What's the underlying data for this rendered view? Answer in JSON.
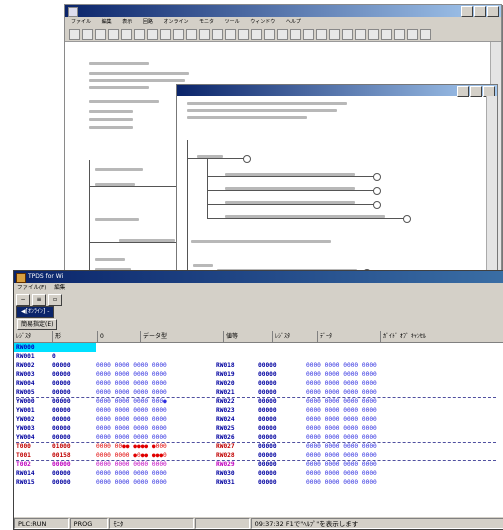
{
  "back_window": {
    "menu": [
      "ファイル",
      "編集",
      "表示",
      "回路",
      "オンライン",
      "モニタ",
      "ツール",
      "ウィンドウ",
      "ヘルプ"
    ]
  },
  "front_window": {
    "title": "TPDS for Wi",
    "menu": [
      "ファイル(F)",
      "編集"
    ],
    "mode_tab": "◀[ｵﾝﾗｲﾝ] -",
    "spec_button": "簡易指定(E)",
    "header": {
      "reg": "ﾚｼﾞｽﾀ",
      "fmt": "形",
      "lbl_a": "0",
      "lbl_b": "データ型",
      "lbl_c": "値等",
      "lbl_d": "ﾚｼﾞｽﾀ",
      "lbl_e": "ﾃﾞｰﾀ",
      "lbl_f": "ｶﾞｲﾄﾞ ｵﾌﾞ ｷｬﾝｾﾙ"
    },
    "rows": [
      {
        "name": "RW000",
        "val": "",
        "bits": "",
        "name2": "",
        "val2": "",
        "bits2": "",
        "style": "selected"
      },
      {
        "name": "RW001",
        "val": "0",
        "bits": "",
        "name2": "",
        "val2": "",
        "bits2": "",
        "style": ""
      },
      {
        "name": "RW002",
        "val": "00000",
        "bits": "0000 0000 0000 0000",
        "name2": "RW018",
        "val2": "00000",
        "bits2": "0000 0000 0000 0000",
        "style": ""
      },
      {
        "name": "RW003",
        "val": "00000",
        "bits": "0000 0000 0000 0000",
        "name2": "RW019",
        "val2": "00000",
        "bits2": "0000 0000 0000 0000",
        "style": ""
      },
      {
        "name": "RW004",
        "val": "00000",
        "bits": "0000 0000 0000 0000",
        "name2": "RW020",
        "val2": "00000",
        "bits2": "0000 0000 0000 0000",
        "style": ""
      },
      {
        "name": "RW005",
        "val": "00000",
        "bits": "0000 0000 0000 0000",
        "name2": "RW021",
        "val2": "00000",
        "bits2": "0000 0000 0000 0000",
        "style": ""
      },
      {
        "name": "YW000",
        "val": "00000",
        "bits": "0000 0000 0000 000●",
        "name2": "RW022",
        "val2": "00000",
        "bits2": "0000 0000 0000 0000",
        "style": ""
      },
      {
        "name": "YW001",
        "val": "00000",
        "bits": "0000 0000 0000 0000",
        "name2": "RW023",
        "val2": "00000",
        "bits2": "0000 0000 0000 0000",
        "style": ""
      },
      {
        "name": "YW002",
        "val": "00000",
        "bits": "0000 0000 0000 0000",
        "name2": "RW024",
        "val2": "00000",
        "bits2": "0000 0000 0000 0000",
        "style": ""
      },
      {
        "name": "YW003",
        "val": "00000",
        "bits": "0000 0000 0000 0000",
        "name2": "RW025",
        "val2": "00000",
        "bits2": "0000 0000 0000 0000",
        "style": ""
      },
      {
        "name": "YW004",
        "val": "00000",
        "bits": "0000 0000 0000 0000",
        "name2": "RW026",
        "val2": "00000",
        "bits2": "0000 0000 0000 0000",
        "style": ""
      },
      {
        "name": "T000",
        "val": "01000",
        "bits": "0000 00●● ●●●● ●000",
        "name2": "RW027",
        "val2": "00000",
        "bits2": "0000 0000 0000 0000",
        "style": "red"
      },
      {
        "name": "T001",
        "val": "00158",
        "bits": "0000 0000 ●0●● ●●●0",
        "name2": "RW028",
        "val2": "00000",
        "bits2": "0000 0000 0000 0000",
        "style": "red"
      },
      {
        "name": "T002",
        "val": "00000",
        "bits": "0000 0000 0000 0000",
        "name2": "RW029",
        "val2": "00000",
        "bits2": "0000 0000 0000 0000",
        "style": "magenta"
      },
      {
        "name": "RW014",
        "val": "00000",
        "bits": "0000 0000 0000 0000",
        "name2": "RW030",
        "val2": "00000",
        "bits2": "0000 0000 0000 0000",
        "style": ""
      },
      {
        "name": "RW015",
        "val": "00000",
        "bits": "0000 0000 0000 0000",
        "name2": "RW031",
        "val2": "00000",
        "bits2": "0000 0000 0000 0000",
        "style": ""
      }
    ],
    "status": {
      "run": "PLC:RUN",
      "mode": "PROG",
      "sub": "ﾓﾆﾀ",
      "message": "09:37:32 F1で\"ﾍﾙﾌﾟ\"を表示します"
    }
  }
}
